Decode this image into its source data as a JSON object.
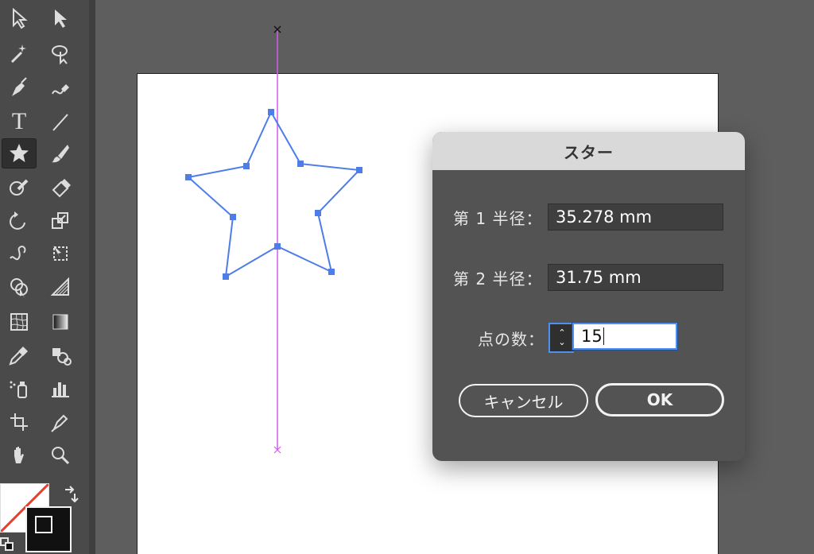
{
  "toolbar": {
    "tools": [
      {
        "name": "selection-tool-icon"
      },
      {
        "name": "direct-selection-tool-icon"
      },
      {
        "name": "magic-wand-tool-icon"
      },
      {
        "name": "lasso-tool-icon"
      },
      {
        "name": "pen-tool-icon"
      },
      {
        "name": "curvature-tool-icon"
      },
      {
        "name": "type-tool-icon",
        "glyph": "T"
      },
      {
        "name": "line-segment-tool-icon"
      },
      {
        "name": "star-tool-icon"
      },
      {
        "name": "paintbrush-tool-icon"
      },
      {
        "name": "shaper-tool-icon"
      },
      {
        "name": "eraser-tool-icon"
      },
      {
        "name": "rotate-tool-icon"
      },
      {
        "name": "scale-tool-icon"
      },
      {
        "name": "warp-tool-icon"
      },
      {
        "name": "free-transform-tool-icon"
      },
      {
        "name": "shape-builder-tool-icon"
      },
      {
        "name": "perspective-grid-tool-icon"
      },
      {
        "name": "mesh-tool-icon"
      },
      {
        "name": "gradient-tool-icon"
      },
      {
        "name": "eyedropper-tool-icon"
      },
      {
        "name": "blend-tool-icon"
      },
      {
        "name": "symbol-sprayer-tool-icon"
      },
      {
        "name": "column-graph-tool-icon"
      },
      {
        "name": "artboard-tool-icon"
      },
      {
        "name": "slice-tool-icon"
      },
      {
        "name": "hand-tool-icon"
      },
      {
        "name": "zoom-tool-icon"
      }
    ]
  },
  "dialog": {
    "title": "スター",
    "radius1_label": "第 1 半径：",
    "radius1_value": "35.278 mm",
    "radius2_label": "第 2 半径：",
    "radius2_value": "31.75 mm",
    "points_label": "点の数：",
    "points_value": "15",
    "stepper_up": "⌃",
    "stepper_down": "⌄",
    "cancel_label": "キャンセル",
    "ok_label": "OK"
  },
  "colors": {
    "star_path": "#4f7de8",
    "guide": "#d35af0",
    "focus": "#4f8ff0"
  }
}
